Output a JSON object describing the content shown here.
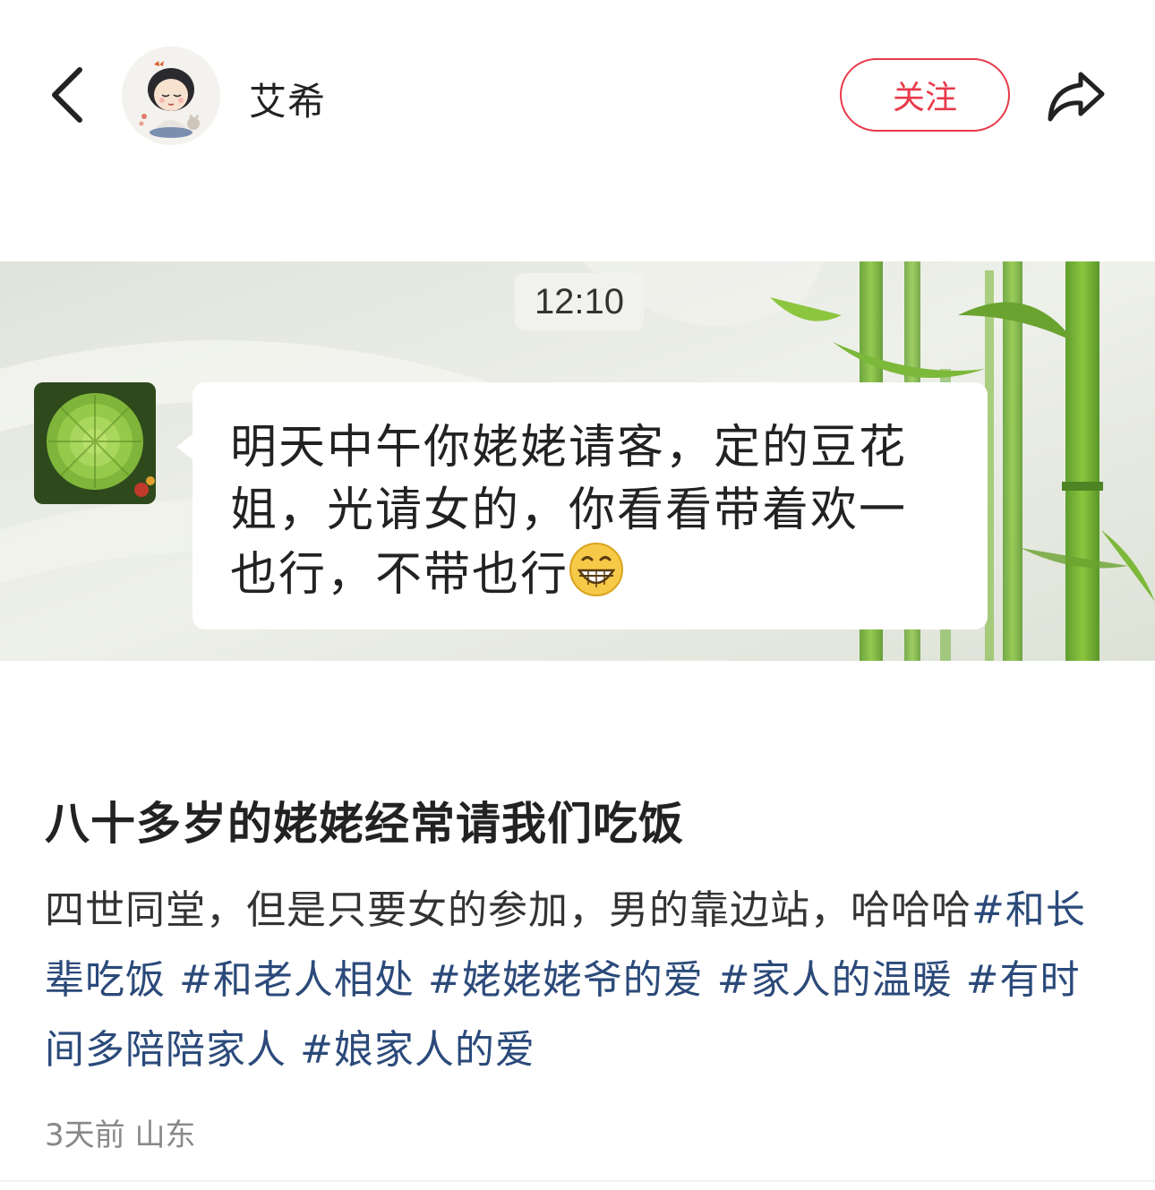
{
  "header": {
    "back_icon": "chevron-left-icon",
    "username": "艾希",
    "follow_label": "关注",
    "share_icon": "share-arrow-icon",
    "accent_color": "#e8394a"
  },
  "chat_screenshot": {
    "time": "12:10",
    "message_lines": [
      "明天中午你姥姥请客，定的豆花",
      "姐，光请女的，你看看带着欢一",
      "也行，不带也行"
    ],
    "emoji": "grin-emoji"
  },
  "post": {
    "title": "八十多岁的姥姥经常请我们吃饭",
    "body_text": "四世同堂，但是只要女的参加，男的靠边站，哈哈哈",
    "hashtags": [
      "#和长辈吃饭",
      "#和老人相处",
      "#姥姥姥爷的爱",
      "#家人的温暖",
      "#有时间多陪陪家人",
      "#娘家人的爱"
    ],
    "hashtag_color": "#2b4a7a",
    "time_ago": "3天前",
    "location": "山东"
  }
}
